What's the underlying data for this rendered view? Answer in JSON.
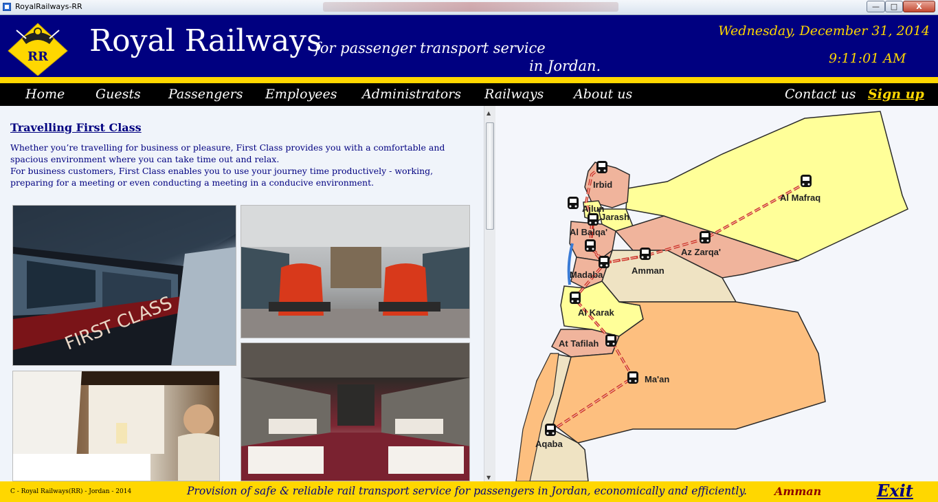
{
  "window": {
    "title": "RoyalRailways-RR",
    "min_label": "—",
    "max_label": "□",
    "close_label": "X"
  },
  "header": {
    "brand": "Royal Railways",
    "logo_text": "RR",
    "tagline_line1": "for passenger transport service",
    "tagline_line2": "in Jordan.",
    "date": "Wednesday, December 31, 2014",
    "time": "9:11:01 AM"
  },
  "nav": {
    "items": [
      "Home",
      "Guests",
      "Passengers",
      "Employees",
      "Administrators",
      "Railways",
      "About us"
    ],
    "contact": "Contact us",
    "signup": "Sign up"
  },
  "content": {
    "title": "Travelling First Class",
    "paragraph1": "Whether you’re travelling for business or pleasure, First Class provides you with a comfortable and spacious environment where you can take time out and relax.",
    "paragraph2": "For business customers, First Class enables you to use your journey time productively - working, preparing for a meeting or even conducting a meeting in a conducive environment.",
    "photo1_text": "FIRST CLASS"
  },
  "map": {
    "regions": [
      "Irbid",
      "Ajlun",
      "Jarash",
      "Al Mafraq",
      "Al Balqa'",
      "Az Zarqa'",
      "Amman",
      "Madaba",
      "Al Karak",
      "At Tafilah",
      "Ma'an",
      "Aqaba"
    ],
    "colors": {
      "yellow": "#ffff99",
      "salmon": "#f0b49c",
      "orange": "#fdbf7f",
      "tan": "#efe3c3",
      "rail": "#c8281e"
    }
  },
  "footer": {
    "copyright": "C - Royal Railways(RR) - Jordan - 2014",
    "mission": "Provision of safe & reliable rail transport service for passengers in Jordan, economically and efficiently.",
    "city": "Amman",
    "exit": "Exit"
  },
  "colors": {
    "navy": "#000080",
    "gold": "#ffd700",
    "black": "#000000"
  }
}
